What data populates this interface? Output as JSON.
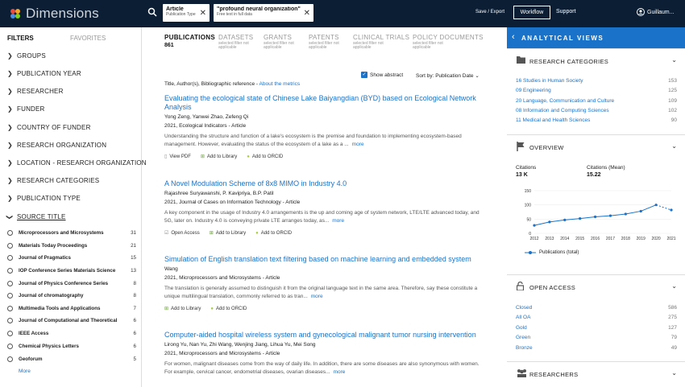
{
  "app": {
    "name": "Dimensions"
  },
  "topbar": {
    "chips": [
      {
        "title": "Article",
        "subtitle": "Publication Type"
      },
      {
        "title": "\"profound neural organization\" ...",
        "subtitle": "Free text in full data"
      }
    ],
    "save_export": "Save / Export",
    "workflow": "Workflow",
    "support": "Support",
    "user": "Guillaum..."
  },
  "left": {
    "tab_filters": "FILTERS",
    "tab_favorites": "FAVORITES",
    "facets": [
      "GROUPS",
      "PUBLICATION YEAR",
      "RESEARCHER",
      "FUNDER",
      "COUNTRY OF FUNDER",
      "RESEARCH ORGANIZATION",
      "LOCATION - RESEARCH ORGANIZATION",
      "RESEARCH CATEGORIES",
      "PUBLICATION TYPE"
    ],
    "source_title": "SOURCE TITLE",
    "sources": [
      {
        "name": "Microprocessors and Microsystems",
        "count": "31"
      },
      {
        "name": "Materials Today Proceedings",
        "count": "21"
      },
      {
        "name": "Journal of Pragmatics",
        "count": "15"
      },
      {
        "name": "IOP Conference Series Materials Science",
        "count": "13"
      },
      {
        "name": "Journal of Physics Conference Series",
        "count": "8"
      },
      {
        "name": "Journal of chromatography",
        "count": "8"
      },
      {
        "name": "Multimedia Tools and Applications",
        "count": "7"
      },
      {
        "name": "Journal of Computational and Theoretical",
        "count": "6"
      },
      {
        "name": "IEEE Access",
        "count": "6"
      },
      {
        "name": "Chemical Physics Letters",
        "count": "6"
      },
      {
        "name": "Geoforum",
        "count": "5"
      }
    ],
    "more": "More"
  },
  "main": {
    "pub_tab": {
      "label": "PUBLICATIONS",
      "count": "861"
    },
    "other_tabs": [
      {
        "label": "DATASETS",
        "sub": "selected filter not applicable"
      },
      {
        "label": "GRANTS",
        "sub": "selected filter not applicable"
      },
      {
        "label": "PATENTS",
        "sub": "selected filter not applicable"
      },
      {
        "label": "CLINICAL TRIALS",
        "sub": "selected filter not applicable"
      },
      {
        "label": "POLICY DOCUMENTS",
        "sub": "selected filter not applicable"
      }
    ],
    "show_abstract": "Show abstract",
    "sort_by": "Sort by: Publication Date",
    "header_text": "Title, Author(s), Bibliographic reference -",
    "about_metrics": "About the metrics",
    "results": [
      {
        "title": "Evaluating the ecological state of Chinese Lake Baiyangdian (BYD) based on Ecological Network Analysis",
        "authors": "Yong Zeng, Yanwei Zhao, Zefeng Qi",
        "journal": "2021, Ecological Indicators - Article",
        "abstract": "Understanding the structure and function of a lake's ecosystem is the premise and foundation to implementing ecosystem-based management. However, evaluating the status of the ecosystem of a lake as a ...",
        "more": "more",
        "actions": [
          "View PDF",
          "Add to Library",
          "Add to ORCID"
        ]
      },
      {
        "title": "A Novel Modulation Scheme of 8x8 MIMO in Industry 4.0",
        "authors": "Rajashree Suryawanshi, P. Kavipriya, B.P. Patil",
        "journal": "2021, Journal of Cases on Information Technology - Article",
        "abstract": "A key component in the usage of Industry 4.0 arrangements is the up and coming age of system network, LTE/LTE advanced today, and 5G, later on. Industry 4.0 is conveying private LTE arranges today, as...",
        "more": "more",
        "actions": [
          "Open Access",
          "Add to Library",
          "Add to ORCID"
        ]
      },
      {
        "title": "Simulation of English translation text filtering based on machine learning and embedded system",
        "authors": "Wang",
        "journal": "2021, Microprocessors and Microsystems - Article",
        "abstract": "The translation is generally assumed to distinguish it from the original language text in the same area. Therefore, say these constitute a unique multilingual translation, commonly referred to as tran...",
        "more": "more",
        "actions": [
          "Add to Library",
          "Add to ORCID"
        ]
      },
      {
        "title": "Computer-aided hospital wireless system and gynecological malignant tumor nursing intervention",
        "authors": "Lirong Yu, Nan Yu, Zhi Wang, Wenjing Jiang, Lihua Yu, Mei Song",
        "journal": "2021, Microprocessors and Microsystems - Article",
        "abstract": "For women, malignant diseases come from the way of daily life. In addition, there are some diseases are also synonymous with women. For example, cervical cancer, endometrial diseases, ovarian diseases...",
        "more": "more",
        "actions": []
      }
    ]
  },
  "right": {
    "header": "ANALYTICAL VIEWS",
    "research_categories": {
      "label": "RESEARCH CATEGORIES",
      "items": [
        {
          "name": "16 Studies in Human Society",
          "count": "153"
        },
        {
          "name": "09 Engineering",
          "count": "125"
        },
        {
          "name": "20 Language, Communication and Culture",
          "count": "109"
        },
        {
          "name": "08 Information and Computing Sciences",
          "count": "102"
        },
        {
          "name": "11 Medical and Health Sciences",
          "count": "90"
        }
      ]
    },
    "overview": {
      "label": "OVERVIEW",
      "citations_label": "Citations",
      "citations_value": "13 K",
      "citations_mean_label": "Citations (Mean)",
      "citations_mean_value": "15.22",
      "legend": "Publications (total)"
    },
    "open_access": {
      "label": "OPEN ACCESS",
      "items": [
        {
          "name": "Closed",
          "count": "586"
        },
        {
          "name": "All OA",
          "count": "275"
        },
        {
          "name": "Gold",
          "count": "127"
        },
        {
          "name": "Green",
          "count": "79"
        },
        {
          "name": "Bronze",
          "count": "49"
        }
      ]
    },
    "researchers": {
      "label": "RESEARCHERS"
    },
    "colors": {
      "accent": "#1a73c9",
      "topbar": "#0b1e34"
    }
  },
  "chart_data": {
    "type": "line",
    "x": [
      "2012",
      "2013",
      "2014",
      "2015",
      "2016",
      "2017",
      "2018",
      "2019",
      "2020",
      "2021"
    ],
    "series": [
      {
        "name": "Publications (total)",
        "values": [
          28,
          40,
          47,
          52,
          58,
          62,
          68,
          78,
          100,
          82
        ]
      }
    ],
    "ylim": [
      0,
      150
    ],
    "yticks": [
      "0",
      "50",
      "100",
      "150"
    ]
  }
}
